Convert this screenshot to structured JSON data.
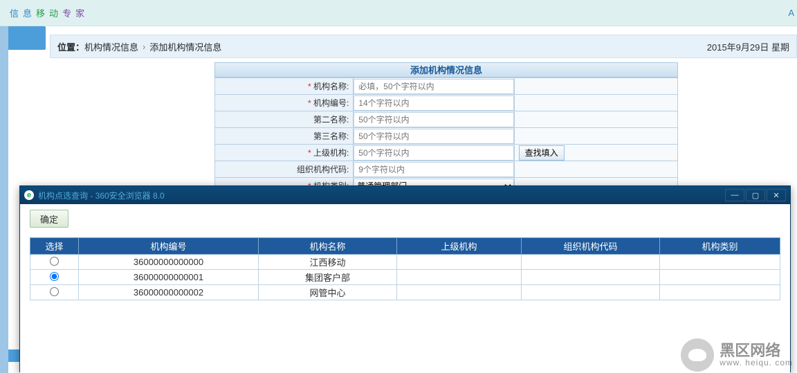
{
  "topbar": {
    "chars": [
      "信",
      "息",
      "移",
      "动",
      "专",
      "家"
    ],
    "admin": "A"
  },
  "breadcrumb": {
    "label": "位置：",
    "a": "机构情况信息",
    "sep": "›",
    "b": "添加机构情况信息",
    "date": "2015年9月29日 星期"
  },
  "panel_title": "添加机构情况信息",
  "form": {
    "rows": [
      {
        "label": "机构名称:",
        "req": true,
        "placeholder": "必填，50个字符以内",
        "btn": ""
      },
      {
        "label": "机构编号:",
        "req": true,
        "placeholder": "14个字符以内",
        "btn": ""
      },
      {
        "label": "第二名称:",
        "req": false,
        "placeholder": "50个字符以内",
        "btn": ""
      },
      {
        "label": "第三名称:",
        "req": false,
        "placeholder": "50个字符以内",
        "btn": ""
      },
      {
        "label": "上级机构:",
        "req": true,
        "placeholder": "50个字符以内",
        "btn": "查找填入"
      },
      {
        "label": "组织机构代码:",
        "req": false,
        "placeholder": "9个字符以内",
        "btn": ""
      },
      {
        "label": "机构类别:",
        "req": true,
        "select": "普通管理部门",
        "btn": ""
      }
    ]
  },
  "popup": {
    "title": "机构点选查询 - 360安全浏览器 8.0",
    "ok": "确定",
    "headers": [
      "选择",
      "机构编号",
      "机构名称",
      "上级机构",
      "组织机构代码",
      "机构类别"
    ],
    "rows": [
      {
        "sel": false,
        "id": "36000000000000",
        "name": "江西移动",
        "parent": "",
        "code": "",
        "type": ""
      },
      {
        "sel": true,
        "id": "36000000000001",
        "name": "集团客户部",
        "parent": "",
        "code": "",
        "type": ""
      },
      {
        "sel": false,
        "id": "36000000000002",
        "name": "网管中心",
        "parent": "",
        "code": "",
        "type": ""
      }
    ]
  },
  "watermark": {
    "big": "黑区网络",
    "small": "www. heiqu. com"
  }
}
